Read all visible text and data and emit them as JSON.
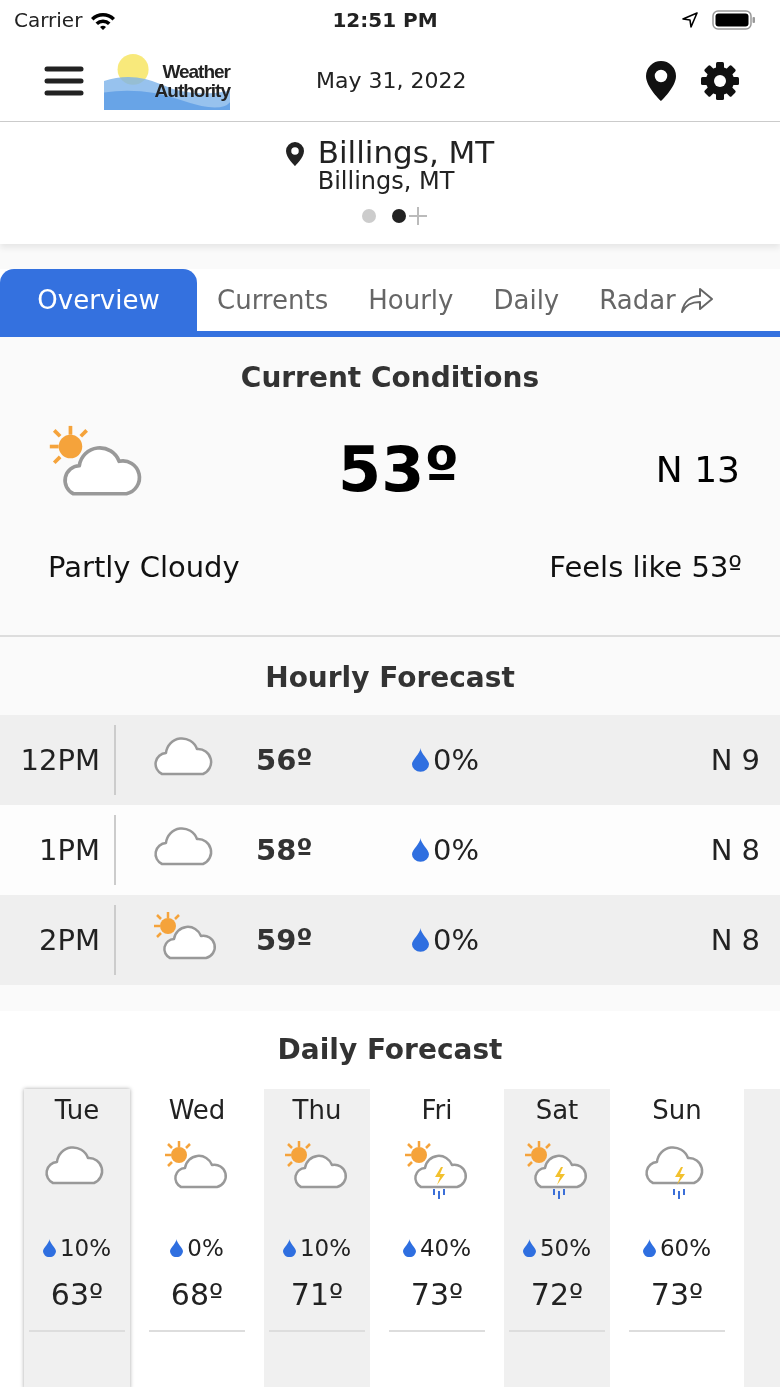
{
  "status_bar": {
    "carrier": "Carrier",
    "time": "12:51 PM"
  },
  "header": {
    "logo": [
      "Weather",
      "Authority"
    ],
    "date": "May 31, 2022"
  },
  "location": {
    "name": "Billings, MT",
    "subtitle": "Billings, MT",
    "pages": [
      {
        "selected": false
      },
      {
        "selected": true
      }
    ]
  },
  "tabs": [
    {
      "label": "Overview",
      "selected": true
    },
    {
      "label": "Currents",
      "selected": false
    },
    {
      "label": "Hourly",
      "selected": false
    },
    {
      "label": "Daily",
      "selected": false
    },
    {
      "label": "Radar",
      "selected": false
    }
  ],
  "current": {
    "title": "Current Conditions",
    "kind": "partly",
    "temperature": "53º",
    "wind": "N 13",
    "condition": "Partly Cloudy",
    "feels_like": "Feels like 53º"
  },
  "hourly": {
    "title": "Hourly Forecast",
    "rows": [
      {
        "time": "12PM",
        "kind": "cloudy",
        "temperature": "56º",
        "precip": "0%",
        "wind": "N 9"
      },
      {
        "time": "1PM",
        "kind": "cloudy",
        "temperature": "58º",
        "precip": "0%",
        "wind": "N 8"
      },
      {
        "time": "2PM",
        "kind": "partly",
        "temperature": "59º",
        "precip": "0%",
        "wind": "N 8"
      }
    ]
  },
  "daily": {
    "title": "Daily Forecast",
    "days": [
      {
        "day": "Tue",
        "kind": "cloudy",
        "precip": "10%",
        "temperature": "63º",
        "selected": true
      },
      {
        "day": "Wed",
        "kind": "partly",
        "precip": "0%",
        "temperature": "68º",
        "selected": false
      },
      {
        "day": "Thu",
        "kind": "partly",
        "precip": "10%",
        "temperature": "71º",
        "selected": false
      },
      {
        "day": "Fri",
        "kind": "storm",
        "precip": "40%",
        "temperature": "73º",
        "selected": false
      },
      {
        "day": "Sat",
        "kind": "storm",
        "precip": "50%",
        "temperature": "72º",
        "selected": false
      },
      {
        "day": "Sun",
        "kind": "thunder",
        "precip": "60%",
        "temperature": "73º",
        "selected": false
      }
    ]
  }
}
